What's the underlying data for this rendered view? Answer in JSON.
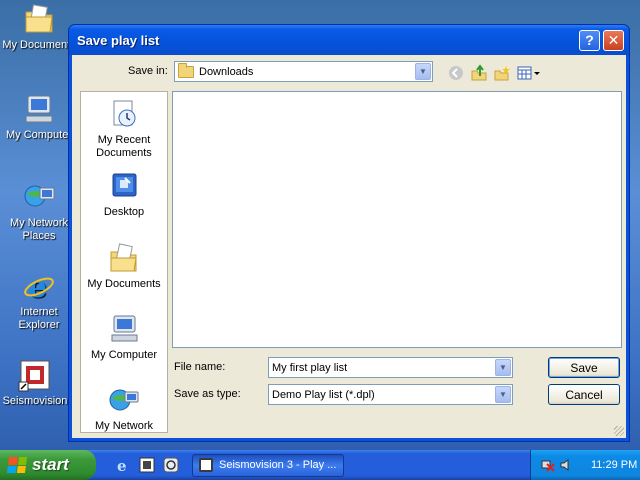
{
  "desktop": {
    "icons": [
      {
        "label": "My Documents",
        "icon": "folder-documents-icon"
      },
      {
        "label": "My Computer",
        "icon": "computer-icon"
      },
      {
        "label": "My Network Places",
        "icon": "network-places-icon"
      },
      {
        "label": "Internet Explorer",
        "icon": "internet-explorer-icon"
      },
      {
        "label": "Seismovision",
        "icon": "seismovision-icon"
      }
    ]
  },
  "dialog": {
    "title": "Save play list",
    "help_glyph": "?",
    "close_glyph": "✕",
    "save_in_label": "Save in:",
    "save_in_value": "Downloads",
    "places": [
      {
        "label": "My Recent Documents",
        "icon": "recent-documents-icon"
      },
      {
        "label": "Desktop",
        "icon": "desktop-icon"
      },
      {
        "label": "My Documents",
        "icon": "my-documents-icon"
      },
      {
        "label": "My Computer",
        "icon": "my-computer-icon"
      },
      {
        "label": "My Network Places",
        "icon": "my-network-icon"
      }
    ],
    "file_name_label": "File name:",
    "file_name_value": "My first play list",
    "save_as_type_label": "Save as type:",
    "save_as_type_value": "Demo Play list (*.dpl)",
    "save_button": "Save",
    "cancel_button": "Cancel"
  },
  "taskbar": {
    "start_label": "start",
    "task_label": "Seismovision 3 - Play ...",
    "clock": "11:29 PM"
  },
  "colors": {
    "title_bar": "#0553dc",
    "dialog_bg": "#ece9d8",
    "start_green": "#3c9a3c",
    "taskbar_blue": "#245edb"
  }
}
